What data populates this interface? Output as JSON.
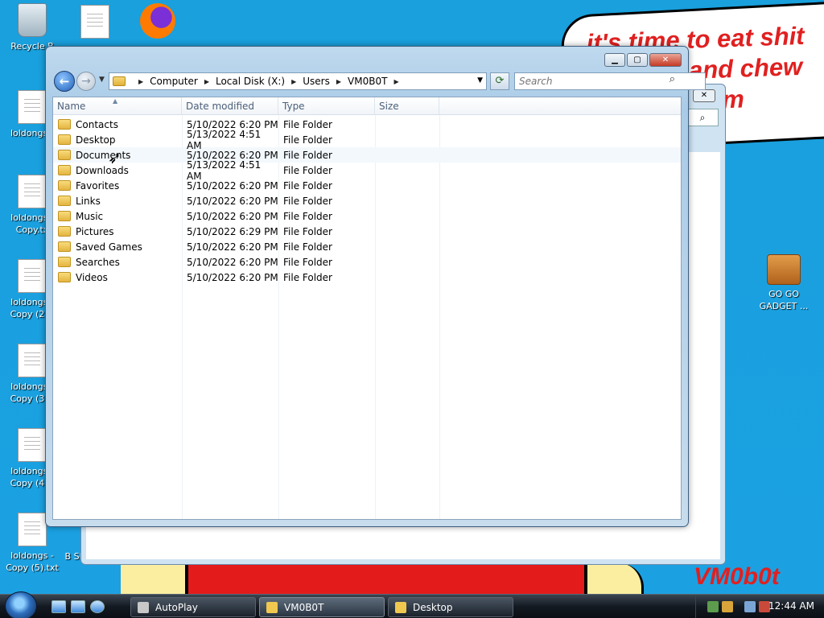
{
  "wallpaper": {
    "bubble_text": [
      "it's time to eat shit",
      "and chew",
      "m"
    ],
    "signature": "VM0b0t"
  },
  "desktop_icons": [
    {
      "name": "recycle-bin",
      "label": "Recycle B"
    },
    {
      "name": "text-file",
      "label": ""
    },
    {
      "name": "firefox",
      "label": ""
    },
    {
      "name": "loldongs-txt",
      "label": "loldongs.t"
    },
    {
      "name": "loldongs-copy",
      "label": "loldongs - Copy.tx"
    },
    {
      "name": "loldongs-copy-2",
      "label": "loldongs - Copy (2).t"
    },
    {
      "name": "loldongs-copy-3",
      "label": "loldongs - Copy (3).t"
    },
    {
      "name": "loldongs-copy-4",
      "label": "loldongs - Copy (4).t"
    },
    {
      "name": "loldongs-copy-5",
      "label": "loldongs - Copy (5).txt"
    },
    {
      "name": "simulator",
      "label": "B SIMULATOR"
    },
    {
      "name": "go-go-gadget",
      "label": "GO GO GADGET ..."
    }
  ],
  "explorer": {
    "breadcrumb": [
      "Computer",
      "Local Disk (X:)",
      "Users",
      "VM0B0T"
    ],
    "search_placeholder": "Search",
    "columns": [
      "Name",
      "Date modified",
      "Type",
      "Size"
    ],
    "rows": [
      {
        "name": "Contacts",
        "date": "5/10/2022 6:20 PM",
        "type": "File Folder",
        "size": ""
      },
      {
        "name": "Desktop",
        "date": "5/13/2022 4:51 AM",
        "type": "File Folder",
        "size": ""
      },
      {
        "name": "Documents",
        "date": "5/10/2022 6:20 PM",
        "type": "File Folder",
        "size": ""
      },
      {
        "name": "Downloads",
        "date": "5/13/2022 4:51 AM",
        "type": "File Folder",
        "size": ""
      },
      {
        "name": "Favorites",
        "date": "5/10/2022 6:20 PM",
        "type": "File Folder",
        "size": ""
      },
      {
        "name": "Links",
        "date": "5/10/2022 6:20 PM",
        "type": "File Folder",
        "size": ""
      },
      {
        "name": "Music",
        "date": "5/10/2022 6:20 PM",
        "type": "File Folder",
        "size": ""
      },
      {
        "name": "Pictures",
        "date": "5/10/2022 6:29 PM",
        "type": "File Folder",
        "size": ""
      },
      {
        "name": "Saved Games",
        "date": "5/10/2022 6:20 PM",
        "type": "File Folder",
        "size": ""
      },
      {
        "name": "Searches",
        "date": "5/10/2022 6:20 PM",
        "type": "File Folder",
        "size": ""
      },
      {
        "name": "Videos",
        "date": "5/10/2022 6:20 PM",
        "type": "File Folder",
        "size": ""
      }
    ]
  },
  "taskbar": {
    "tasks": [
      "AutoPlay",
      "VM0B0T",
      "Desktop"
    ],
    "clock": "12:44 AM"
  },
  "icons": {
    "back": "back-arrow-icon",
    "forward": "forward-arrow-icon",
    "refresh": "refresh-icon",
    "search": "magnifier-icon",
    "folder": "folder-icon"
  }
}
